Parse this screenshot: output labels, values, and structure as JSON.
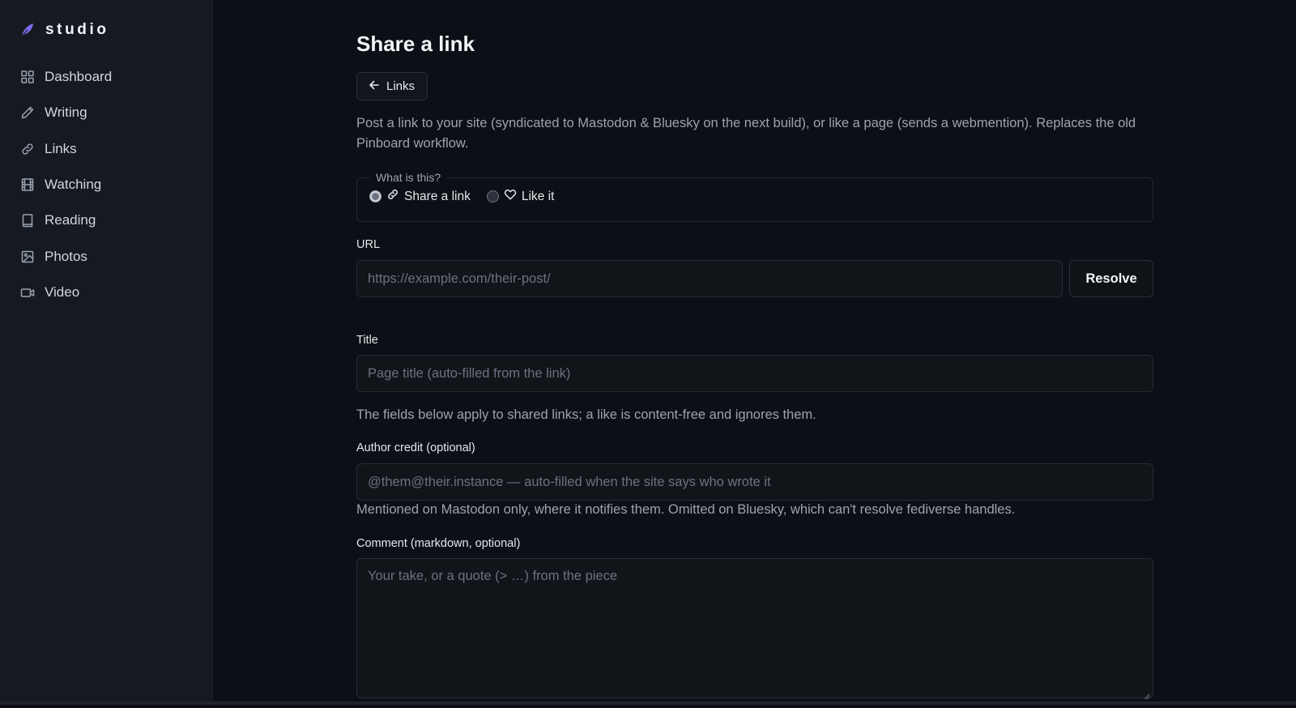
{
  "brand": {
    "name": "studio",
    "accent": "#7c6cf0"
  },
  "sidebar": {
    "items": [
      {
        "label": "Dashboard",
        "icon": "grid-icon"
      },
      {
        "label": "Writing",
        "icon": "pencil-icon"
      },
      {
        "label": "Links",
        "icon": "link-icon"
      },
      {
        "label": "Watching",
        "icon": "film-icon"
      },
      {
        "label": "Reading",
        "icon": "book-icon"
      },
      {
        "label": "Photos",
        "icon": "image-icon"
      },
      {
        "label": "Video",
        "icon": "video-icon"
      }
    ]
  },
  "main": {
    "title": "Share a link",
    "back_label": "Links",
    "intro": "Post a link to your site (syndicated to Mastodon & Bluesky on the next build), or like a page (sends a webmention). Replaces the old Pinboard workflow.",
    "kind": {
      "legend": "What is this?",
      "options": [
        {
          "label": "Share a link",
          "icon": "link-icon",
          "selected": true
        },
        {
          "label": "Like it",
          "icon": "heart-icon",
          "selected": false
        }
      ]
    },
    "url": {
      "label": "URL",
      "placeholder": "https://example.com/their-post/",
      "button": "Resolve"
    },
    "title_field": {
      "label": "Title",
      "placeholder": "Page title (auto-filled from the link)"
    },
    "fields_note": "The fields below apply to shared links; a like is content-free and ignores them.",
    "author": {
      "label": "Author credit (optional)",
      "placeholder": "@them@their.instance — auto-filled when the site says who wrote it",
      "hint": "Mentioned on Mastodon only, where it notifies them. Omitted on Bluesky, which can't resolve fediverse handles."
    },
    "comment": {
      "label": "Comment (markdown, optional)",
      "placeholder": "Your take, or a quote (> …) from the piece"
    }
  }
}
